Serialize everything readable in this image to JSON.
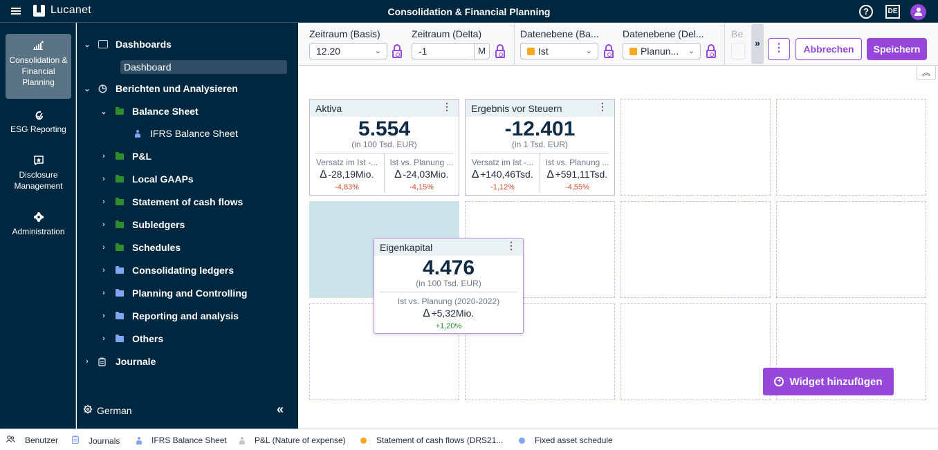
{
  "app": {
    "brand": "Lucanet",
    "title": "Consolidation & Financial Planning",
    "help_label": "?",
    "language_badge": "DE"
  },
  "rail": {
    "items": [
      {
        "label": "Consolidation & Financial Planning",
        "icon": "chart-growth-icon",
        "active": true
      },
      {
        "label": "ESG Reporting",
        "icon": "esg-leaf-icon",
        "active": false
      },
      {
        "label": "Disclosure Management",
        "icon": "disclosure-star-icon",
        "active": false
      },
      {
        "label": "Administration",
        "icon": "gear-icon",
        "active": false
      }
    ]
  },
  "tree": {
    "dashboards": "Dashboards",
    "dashboard_selected": "Dashboard",
    "reports": "Berichten und Analysieren",
    "balance_sheet": "Balance Sheet",
    "ifrs_balance_sheet": "IFRS Balance Sheet",
    "folders": [
      {
        "label": "P&L",
        "color": "green"
      },
      {
        "label": "Local GAAPs",
        "color": "green"
      },
      {
        "label": "Statement of cash flows",
        "color": "green"
      },
      {
        "label": "Subledgers",
        "color": "green"
      },
      {
        "label": "Schedules",
        "color": "green"
      },
      {
        "label": "Consolidating ledgers",
        "color": "blue"
      },
      {
        "label": "Planning and Controlling",
        "color": "blue"
      },
      {
        "label": "Reporting and analysis",
        "color": "blue"
      },
      {
        "label": "Others",
        "color": "blue"
      }
    ],
    "journale": "Journale",
    "language": "German",
    "collapse_label": "«"
  },
  "toolbar": {
    "fields": [
      {
        "label": "Zeitraum (Basis)",
        "value": "12.20"
      },
      {
        "label": "Zeitraum (Delta)",
        "value": "-1",
        "suffix": "M"
      },
      {
        "label": "Datenebene (Ba...",
        "value": "Ist"
      },
      {
        "label": "Datenebene (Del...",
        "value": "Planun..."
      },
      {
        "label": "Be"
      }
    ],
    "overflow_label": "»",
    "more_label": "⋮",
    "cancel_label": "Abbrechen",
    "save_label": "Speichern",
    "collapse_label": "︽"
  },
  "widgets": [
    {
      "title": "Aktiva",
      "value": "5.554",
      "unit": "(in 100 Tsd. EUR)",
      "comparisons": [
        {
          "label": "Versatz im Ist -...",
          "delta": "-28,19Mio.",
          "pct": "-4,83%",
          "trend": "neg"
        },
        {
          "label": "Ist vs. Planung ...",
          "delta": "-24,03Mio.",
          "pct": "-4,15%",
          "trend": "neg"
        }
      ]
    },
    {
      "title": "Ergebnis vor Steuern",
      "value": "-12.401",
      "unit": "(in 1 Tsd. EUR)",
      "comparisons": [
        {
          "label": "Versatz im Ist -...",
          "delta": "+140,46Tsd.",
          "pct": "-1,12%",
          "trend": "neg"
        },
        {
          "label": "Ist vs. Planung ...",
          "delta": "+591,11Tsd.",
          "pct": "-4,55%",
          "trend": "neg"
        }
      ]
    },
    {
      "title": "Eigenkapital",
      "value": "4.476",
      "unit": "(in 100 Tsd. EUR)",
      "comparisons": [
        {
          "label": "Ist vs. Planung (2020-2022)",
          "delta": "+5,32Mio.",
          "pct": "+1,20%",
          "trend": "pos"
        }
      ]
    }
  ],
  "widget_menu_label": "⋮",
  "delta_symbol": "∆",
  "add_widget_label": "Widget hinzufügen",
  "statusbar": [
    {
      "label": "Benutzer",
      "icon": "users-icon"
    },
    {
      "label": "Journals",
      "icon": "journal-icon"
    },
    {
      "label": "IFRS Balance Sheet",
      "icon": "person-icon"
    },
    {
      "label": "P&L (Nature of expense)",
      "icon": "person-icon"
    },
    {
      "label": "Statement of cash flows (DRS21...",
      "icon": "dot-icon",
      "color": "#f6a821"
    },
    {
      "label": "Fixed asset schedule",
      "icon": "dot-icon",
      "color": "#7fa6ee"
    }
  ]
}
